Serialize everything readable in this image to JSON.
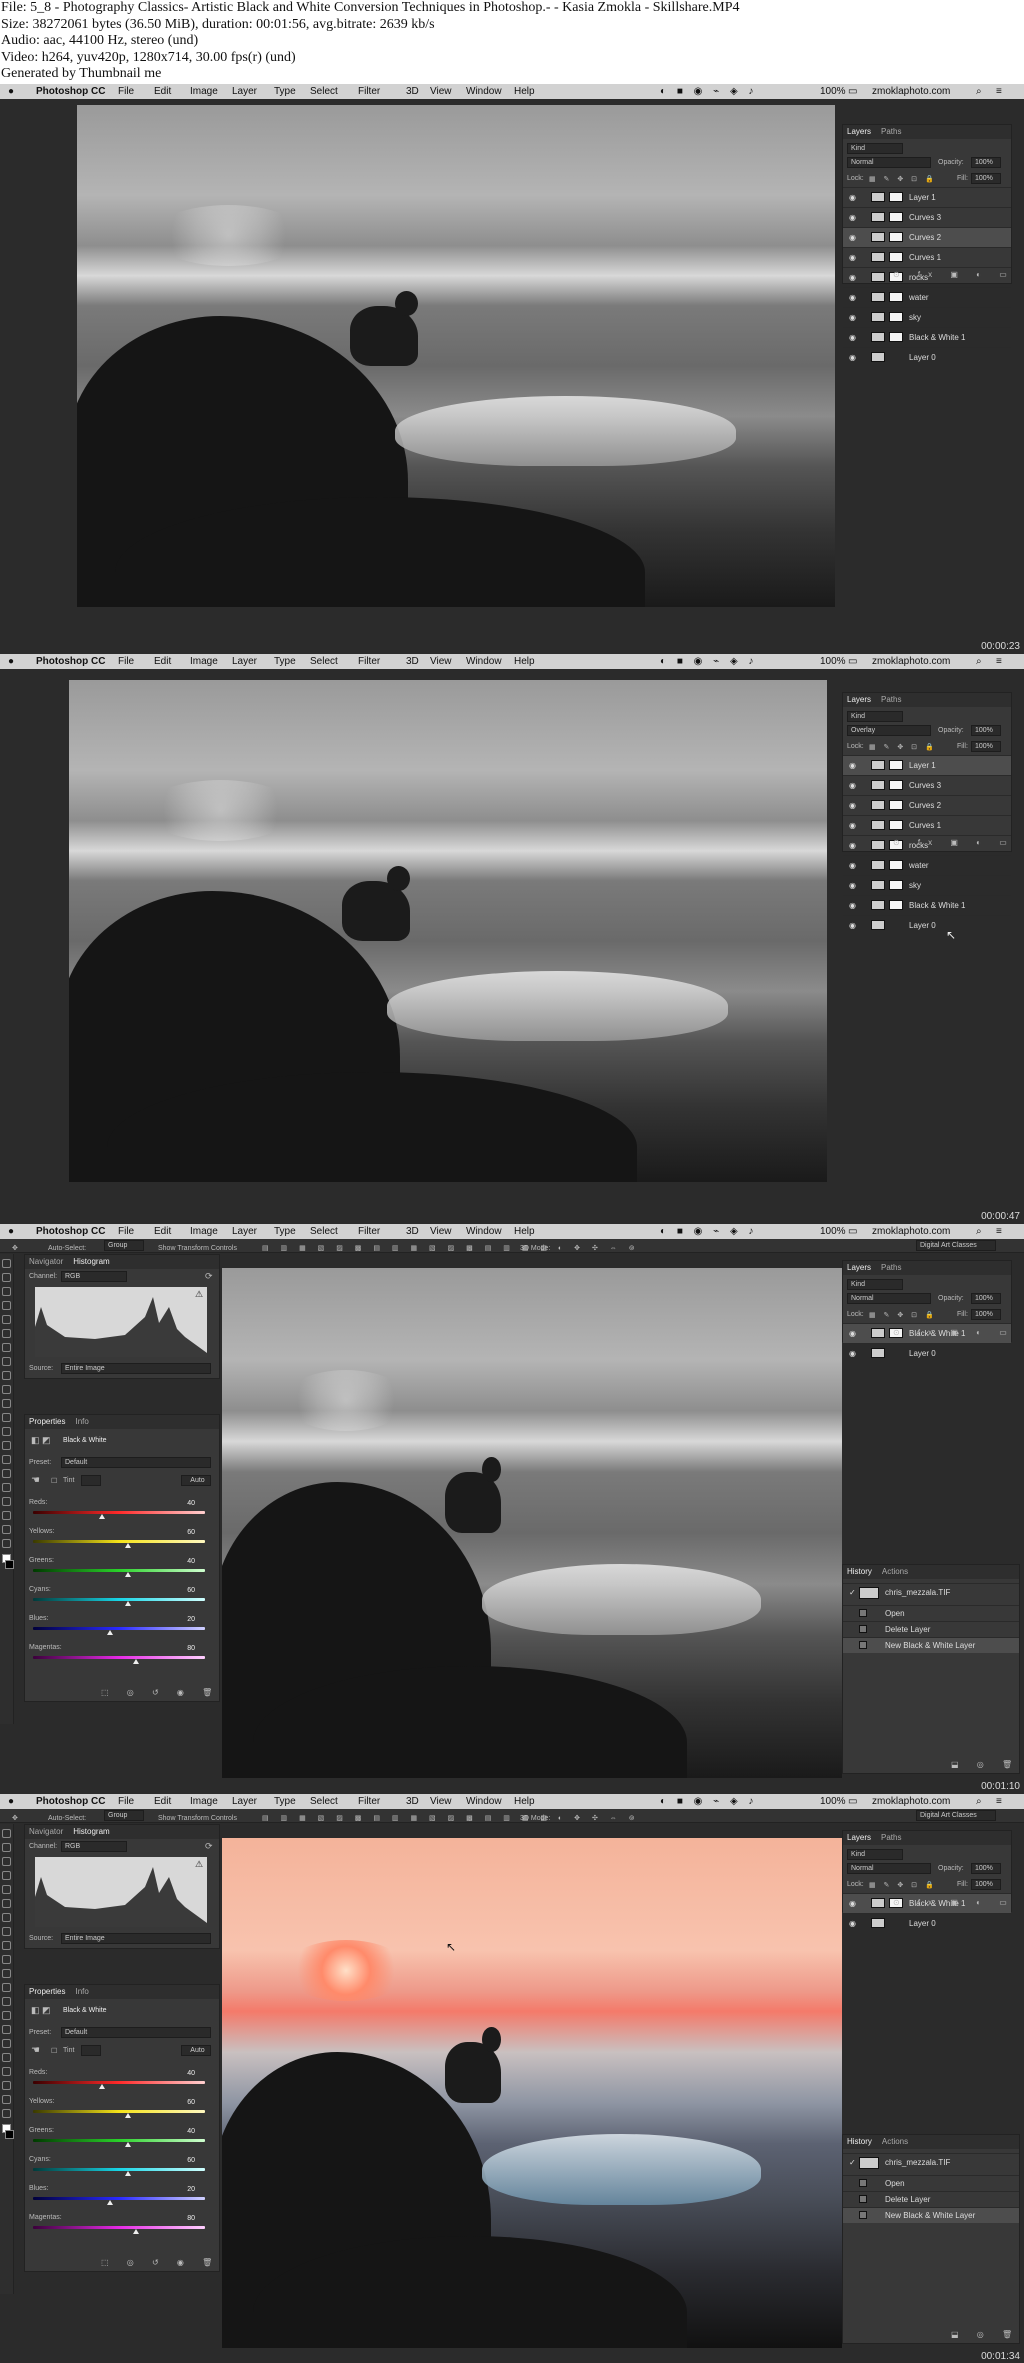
{
  "header": {
    "line1": "File: 5_8 - Photography Classics- Artistic Black and White Conversion Techniques in Photoshop.- - Kasia Zmokla - Skillshare.MP4",
    "line2": "Size: 38272061 bytes (36.50 MiB), duration: 00:01:56, avg.bitrate: 2639 kb/s",
    "line3": "Audio: aac, 44100 Hz, stereo (und)",
    "line4": "Video: h264, yuv420p, 1280x714, 30.00 fps(r) (und)",
    "line5": "Generated by Thumbnail me"
  },
  "menubar": {
    "app": "Photoshop CC",
    "items": [
      "File",
      "Edit",
      "Image",
      "Layer",
      "Type",
      "Select",
      "Filter",
      "3D",
      "View",
      "Window",
      "Help"
    ],
    "zoom": "100%",
    "site": "zmoklaphoto.com"
  },
  "timestamps": [
    "00:00:23",
    "00:00:47",
    "00:01:10",
    "00:01:34"
  ],
  "layers_panel": {
    "tabs": [
      "Layers",
      "Paths"
    ],
    "kind": "Kind",
    "opacity_label": "Opacity:",
    "opacity_value": "100%",
    "fill_label": "Fill:",
    "fill_value": "100%",
    "lock_label": "Lock:",
    "blend_normal": "Normal",
    "blend_overlay": "Overlay",
    "layers_full": [
      "Layer 1",
      "Curves 3",
      "Curves 2",
      "Curves 1",
      "rocks",
      "water",
      "sky",
      "Black & White 1",
      "Layer 0"
    ],
    "layers_short": [
      "Black & White 1",
      "Layer 0"
    ]
  },
  "options_bar": {
    "auto_select": "Auto-Select:",
    "group": "Group",
    "transform": "Show Transform Controls",
    "mode3d": "3D Mode:",
    "workspace": "Digital Art Classes"
  },
  "histogram_panel": {
    "tabs": [
      "Navigator",
      "Histogram"
    ],
    "channel_label": "Channel:",
    "channel_value": "RGB",
    "source_label": "Source:",
    "source_value": "Entire Image"
  },
  "properties_panel": {
    "tabs": [
      "Properties",
      "Info"
    ],
    "title": "Black & White",
    "preset_label": "Preset:",
    "preset_value": "Default",
    "tint": "Tint",
    "auto": "Auto",
    "sliders": [
      {
        "label": "Reds:",
        "value": "40",
        "pos": 0.4,
        "color": "red"
      },
      {
        "label": "Yellows:",
        "value": "60",
        "pos": 0.55,
        "color": "yellow"
      },
      {
        "label": "Greens:",
        "value": "40",
        "pos": 0.55,
        "color": "green"
      },
      {
        "label": "Cyans:",
        "value": "60",
        "pos": 0.55,
        "color": "cyan"
      },
      {
        "label": "Blues:",
        "value": "20",
        "pos": 0.45,
        "color": "blue"
      },
      {
        "label": "Magentas:",
        "value": "80",
        "pos": 0.6,
        "color": "magenta"
      }
    ]
  },
  "history_panel": {
    "tabs": [
      "History",
      "Actions"
    ],
    "snapshot": "chris_mezzala.TIF",
    "steps": [
      "Open",
      "Delete Layer",
      "New Black & White Layer"
    ]
  }
}
